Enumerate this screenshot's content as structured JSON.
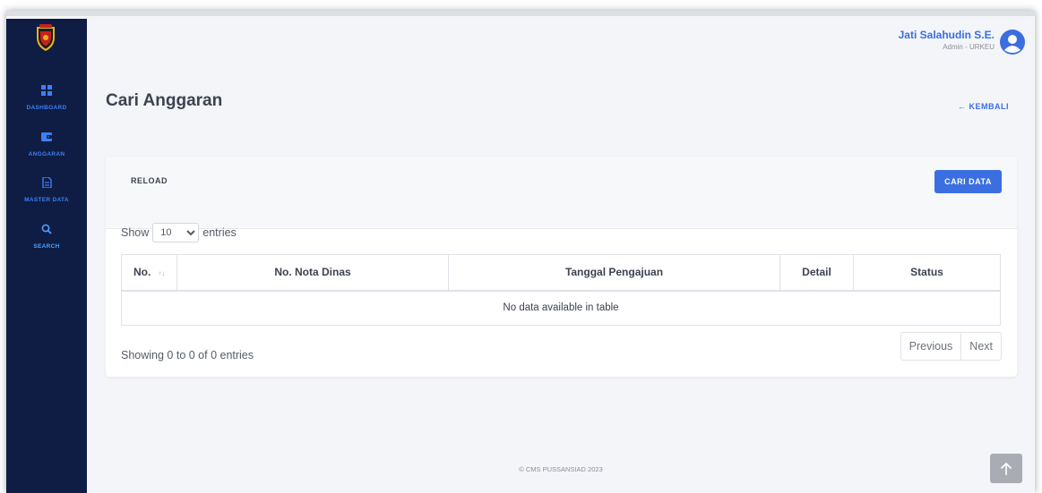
{
  "sidebar": {
    "items": [
      {
        "label": "DASHBOARD",
        "icon": "dashboard-grid-icon"
      },
      {
        "label": "ANGGARAN",
        "icon": "wallet-icon"
      },
      {
        "label": "MASTER DATA",
        "icon": "document-icon"
      },
      {
        "label": "SEARCH",
        "icon": "search-icon"
      }
    ]
  },
  "user": {
    "name": "Jati Salahudin S.E.",
    "role": "Admin - URKEU"
  },
  "page": {
    "title": "Cari Anggaran",
    "back_label": "← KEMBALI"
  },
  "card": {
    "reload_label": "RELOAD",
    "search_button_label": "CARI DATA",
    "length": {
      "show_label": "Show",
      "selected": "10",
      "entries_label": "entries"
    },
    "table": {
      "columns": [
        "No.",
        "No. Nota Dinas",
        "Tanggal Pengajuan",
        "Detail",
        "Status"
      ],
      "sort_indicator": "↑↓",
      "empty_message": "No data available in table"
    },
    "info": "Showing 0 to 0 of 0 entries",
    "pagination": {
      "previous": "Previous",
      "next": "Next"
    }
  },
  "footer": {
    "text": "© CMS PUSSANSIAD 2023"
  },
  "colors": {
    "sidebar_bg": "#0f1c44",
    "accent": "#3b6ee0",
    "page_bg": "#f3f5f8"
  }
}
